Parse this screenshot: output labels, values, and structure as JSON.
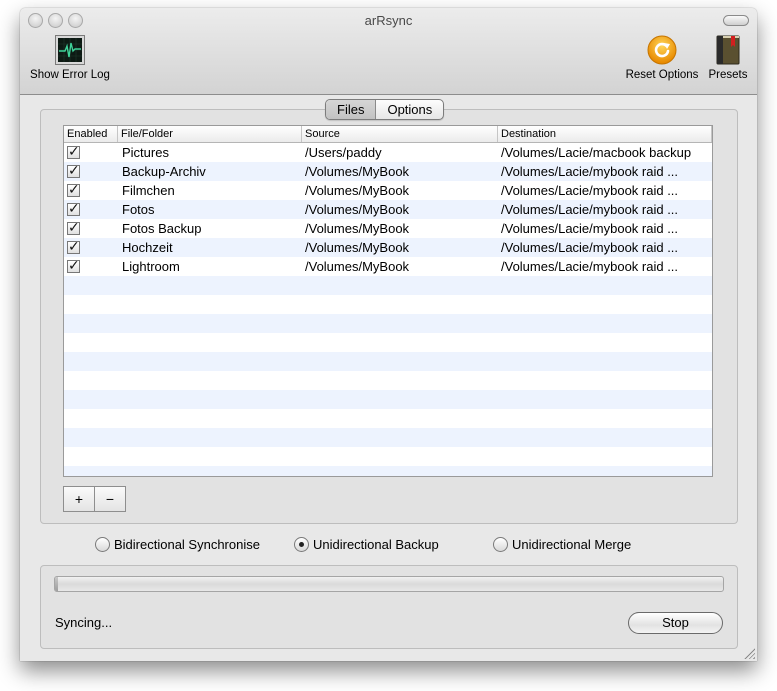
{
  "window": {
    "title": "arRsync"
  },
  "toolbar": {
    "show_error_log": {
      "label": "Show Error Log",
      "icon": "activity-monitor-icon"
    },
    "reset_options": {
      "label": "Reset Options",
      "icon": "reset-icon"
    },
    "presets": {
      "label": "Presets",
      "icon": "book-icon"
    }
  },
  "tabs": [
    {
      "label": "Files",
      "selected": true
    },
    {
      "label": "Options",
      "selected": false
    }
  ],
  "table": {
    "columns": [
      "Enabled",
      "File/Folder",
      "Source",
      "Destination"
    ],
    "rows": [
      {
        "enabled": true,
        "name": "Pictures",
        "source": "/Users/paddy",
        "destination": "/Volumes/Lacie/macbook backup"
      },
      {
        "enabled": true,
        "name": "Backup-Archiv",
        "source": "/Volumes/MyBook",
        "destination": "/Volumes/Lacie/mybook raid ..."
      },
      {
        "enabled": true,
        "name": "Filmchen",
        "source": "/Volumes/MyBook",
        "destination": "/Volumes/Lacie/mybook raid ..."
      },
      {
        "enabled": true,
        "name": "Fotos",
        "source": "/Volumes/MyBook",
        "destination": "/Volumes/Lacie/mybook raid ..."
      },
      {
        "enabled": true,
        "name": "Fotos Backup",
        "source": "/Volumes/MyBook",
        "destination": "/Volumes/Lacie/mybook raid ..."
      },
      {
        "enabled": true,
        "name": "Hochzeit",
        "source": "/Volumes/MyBook",
        "destination": "/Volumes/Lacie/mybook raid ..."
      },
      {
        "enabled": true,
        "name": "Lightroom",
        "source": "/Volumes/MyBook",
        "destination": "/Volumes/Lacie/mybook raid ..."
      }
    ]
  },
  "buttons": {
    "add": "+",
    "remove": "−",
    "stop": "Stop"
  },
  "sync_modes": [
    {
      "label": "Bidirectional Synchronise",
      "selected": false
    },
    {
      "label": "Unidirectional Backup",
      "selected": true
    },
    {
      "label": "Unidirectional Merge",
      "selected": false
    }
  ],
  "progress": {
    "percent": 0.5
  },
  "status": {
    "text": "Syncing..."
  }
}
